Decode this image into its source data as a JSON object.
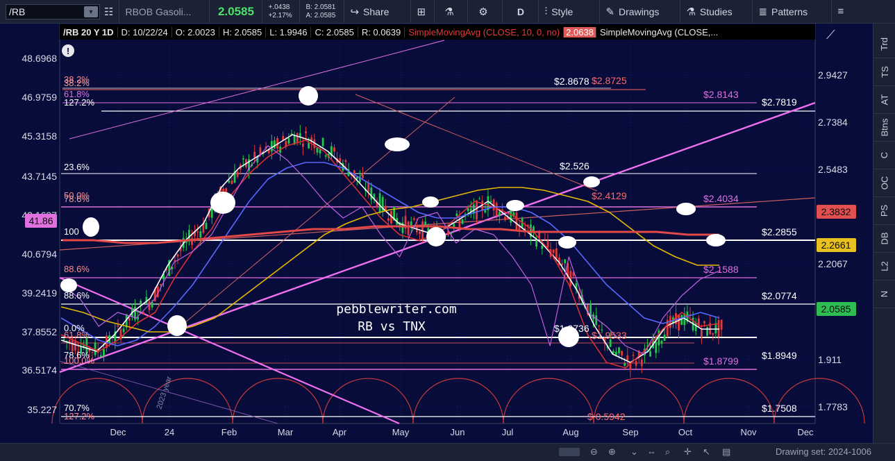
{
  "toolbar": {
    "symbol": "/RB",
    "instrument": "RBOB Gasoli...",
    "last": "2.0585",
    "change": "+.0438",
    "change_pct": "+2.17%",
    "bid": "B: 2.0581",
    "ask": "A: 2.0585",
    "share": "Share",
    "aggregation": "D",
    "style": "Style",
    "drawings": "Drawings",
    "studies": "Studies",
    "patterns": "Patterns"
  },
  "header": {
    "symbol": "/RB 20 Y 1D",
    "date": "D: 10/22/24",
    "open": "O: 2.0023",
    "high": "H: 2.0585",
    "low": "L: 1.9946",
    "close": "C: 2.0585",
    "range": "R: 0.0639",
    "sma1": "SimpleMovingAvg (CLOSE, 10, 0, no)",
    "sma1_value": "2.0638",
    "sma2": "SimpleMovingAvg (CLOSE,..."
  },
  "side_tabs": [
    "Trd",
    "TS",
    "AT",
    "Btns",
    "C",
    "OC",
    "PS",
    "DB",
    "L2",
    "N"
  ],
  "bottom": {
    "drawing_set": "Drawing set: 2024-1006"
  },
  "chart_data": {
    "type": "line",
    "watermark_line1": "pebblewriter.com",
    "watermark_line2": "RB vs TNX",
    "period_label": "2023 year",
    "x_labels": [
      "Dec",
      "24",
      "Feb",
      "Mar",
      "Apr",
      "May",
      "Jun",
      "Jul",
      "Aug",
      "Sep",
      "Oct",
      "Nov",
      "Dec"
    ],
    "left_axis": [
      "48.6968",
      "46.9759",
      "45.3158",
      "43.7145",
      "42.1697",
      "40.6794",
      "39.2419",
      "37.8552",
      "36.5174",
      "35.227"
    ],
    "right_axis": [
      "2.9427",
      "2.7384",
      "2.5483",
      "2.2067",
      "1.911",
      "1.7783"
    ],
    "left_badge": "41.86",
    "price_badges": [
      {
        "value": "2.3832",
        "color": "#e05050"
      },
      {
        "value": "2.2661",
        "color": "#e8c020"
      },
      {
        "value": "2.0585",
        "color": "#2ebd52"
      }
    ],
    "fib_left_labels": [
      {
        "text": "38.2%",
        "color": "#ff8a8a"
      },
      {
        "text": "38.2%",
        "color": "#f0a0a0"
      },
      {
        "text": "61.8%",
        "color": "#e070e0"
      },
      {
        "text": "127.2%",
        "color": "#ffffff"
      },
      {
        "text": "23.6%",
        "color": "#ffffff"
      },
      {
        "text": "50.0%",
        "color": "#ff8a8a"
      },
      {
        "text": "78.6%",
        "color": "#f0a0a0"
      },
      {
        "text": "100",
        "color": "#ffffff"
      },
      {
        "text": "88.6%",
        "color": "#ff8a8a"
      },
      {
        "text": "88.6%",
        "color": "#ffffff"
      },
      {
        "text": "0.0%",
        "color": "#ffffff"
      },
      {
        "text": "61.8%",
        "color": "#ff8a8a"
      },
      {
        "text": "78.6%",
        "color": "#ffffff"
      },
      {
        "text": "100.0%",
        "color": "#ff8a8a"
      },
      {
        "text": "70.7%",
        "color": "#ffffff"
      },
      {
        "text": "127.2%",
        "color": "#ff8a8a"
      }
    ],
    "level_labels": [
      {
        "text": "$2.8678",
        "color": "#ffffff"
      },
      {
        "text": "$2.8725",
        "color": "#ff6a6a"
      },
      {
        "text": "$2.8143",
        "color": "#e070e0"
      },
      {
        "text": "$2.7819",
        "color": "#ffffff"
      },
      {
        "text": "$2.526",
        "color": "#ffffff"
      },
      {
        "text": "$2.4129",
        "color": "#ff6a6a"
      },
      {
        "text": "$2.4034",
        "color": "#e070e0"
      },
      {
        "text": "$2.2855",
        "color": "#ffffff"
      },
      {
        "text": "$2.1588",
        "color": "#e070e0"
      },
      {
        "text": "$2.0774",
        "color": "#ffffff"
      },
      {
        "text": "$1.9736",
        "color": "#ffffff"
      },
      {
        "text": "$1.9533",
        "color": "#ff6a6a"
      },
      {
        "text": "$1.8949",
        "color": "#ffffff"
      },
      {
        "text": "$1.8799",
        "color": "#e070e0"
      },
      {
        "text": "$1.7508",
        "color": "#ffffff"
      },
      {
        "text": "$ 0.5942",
        "color": "#ff6a6a"
      }
    ],
    "series": [
      {
        "name": "",
        "color": "#ffffff",
        "values": [
          2.0,
          1.98,
          1.96,
          2.02,
          2.1,
          2.15,
          2.27,
          2.36,
          2.42,
          2.55,
          2.62,
          2.66,
          2.7,
          2.74,
          2.72,
          2.68,
          2.62,
          2.55,
          2.48,
          2.42,
          2.4,
          2.38,
          2.42,
          2.46,
          2.5,
          2.45,
          2.4,
          2.35,
          2.28,
          2.18,
          2.05,
          1.95,
          1.92,
          1.96,
          2.05,
          2.08,
          2.04,
          2.04
        ]
      },
      {
        "name": "",
        "color": "#d83030",
        "values": [
          2.02,
          1.99,
          1.96,
          2.0,
          2.06,
          2.1,
          2.22,
          2.32,
          2.4,
          2.52,
          2.6,
          2.66,
          2.7,
          2.72,
          2.68,
          2.6,
          2.52,
          2.44,
          2.38,
          2.36,
          2.38,
          2.44,
          2.5,
          2.48,
          2.45,
          2.4,
          2.32,
          2.2,
          2.02,
          1.92,
          1.9,
          1.96,
          2.04,
          2.1,
          2.05,
          2.06
        ]
      },
      {
        "name": "",
        "color": "#5868ff",
        "values": [
          2.08,
          2.04,
          2.0,
          1.98,
          2.0,
          2.05,
          2.12,
          2.2,
          2.3,
          2.4,
          2.5,
          2.58,
          2.62,
          2.64,
          2.64,
          2.62,
          2.58,
          2.54,
          2.5,
          2.46,
          2.44,
          2.44,
          2.46,
          2.48,
          2.48,
          2.46,
          2.42,
          2.36,
          2.28,
          2.2,
          2.14,
          2.08,
          2.06,
          2.08,
          2.1,
          2.08
        ]
      },
      {
        "name": "",
        "color": "#e8b800",
        "values": [
          2.12,
          2.1,
          2.07,
          2.05,
          2.03,
          2.03,
          2.05,
          2.08,
          2.14,
          2.2,
          2.26,
          2.32,
          2.38,
          2.42,
          2.45,
          2.47,
          2.48,
          2.5,
          2.52,
          2.54,
          2.55,
          2.55,
          2.54,
          2.52,
          2.5,
          2.46,
          2.4,
          2.34,
          2.3,
          2.27,
          2.27
        ]
      },
      {
        "name": "",
        "color": "#e04848",
        "values": [
          2.36,
          2.36,
          2.35,
          2.35,
          2.36,
          2.37,
          2.38,
          2.39,
          2.4,
          2.4,
          2.41,
          2.41,
          2.41,
          2.4,
          2.4,
          2.39,
          2.39,
          2.39,
          2.39,
          2.39,
          2.38,
          2.38
        ]
      },
      {
        "name": "",
        "color": "#c060e0",
        "values": [
          2.2,
          2.15,
          2.05,
          2.1,
          2.08,
          2.15,
          2.28,
          2.32,
          2.38,
          2.5,
          2.62,
          2.7,
          2.65,
          2.58,
          2.5,
          2.44,
          2.48,
          2.38,
          2.3,
          2.44,
          2.46,
          2.35,
          2.4,
          2.38,
          2.3,
          2.2,
          1.98,
          2.3,
          2.1,
          2.05,
          1.98,
          1.95,
          2.08,
          2.16,
          2.22,
          2.25
        ]
      }
    ]
  }
}
